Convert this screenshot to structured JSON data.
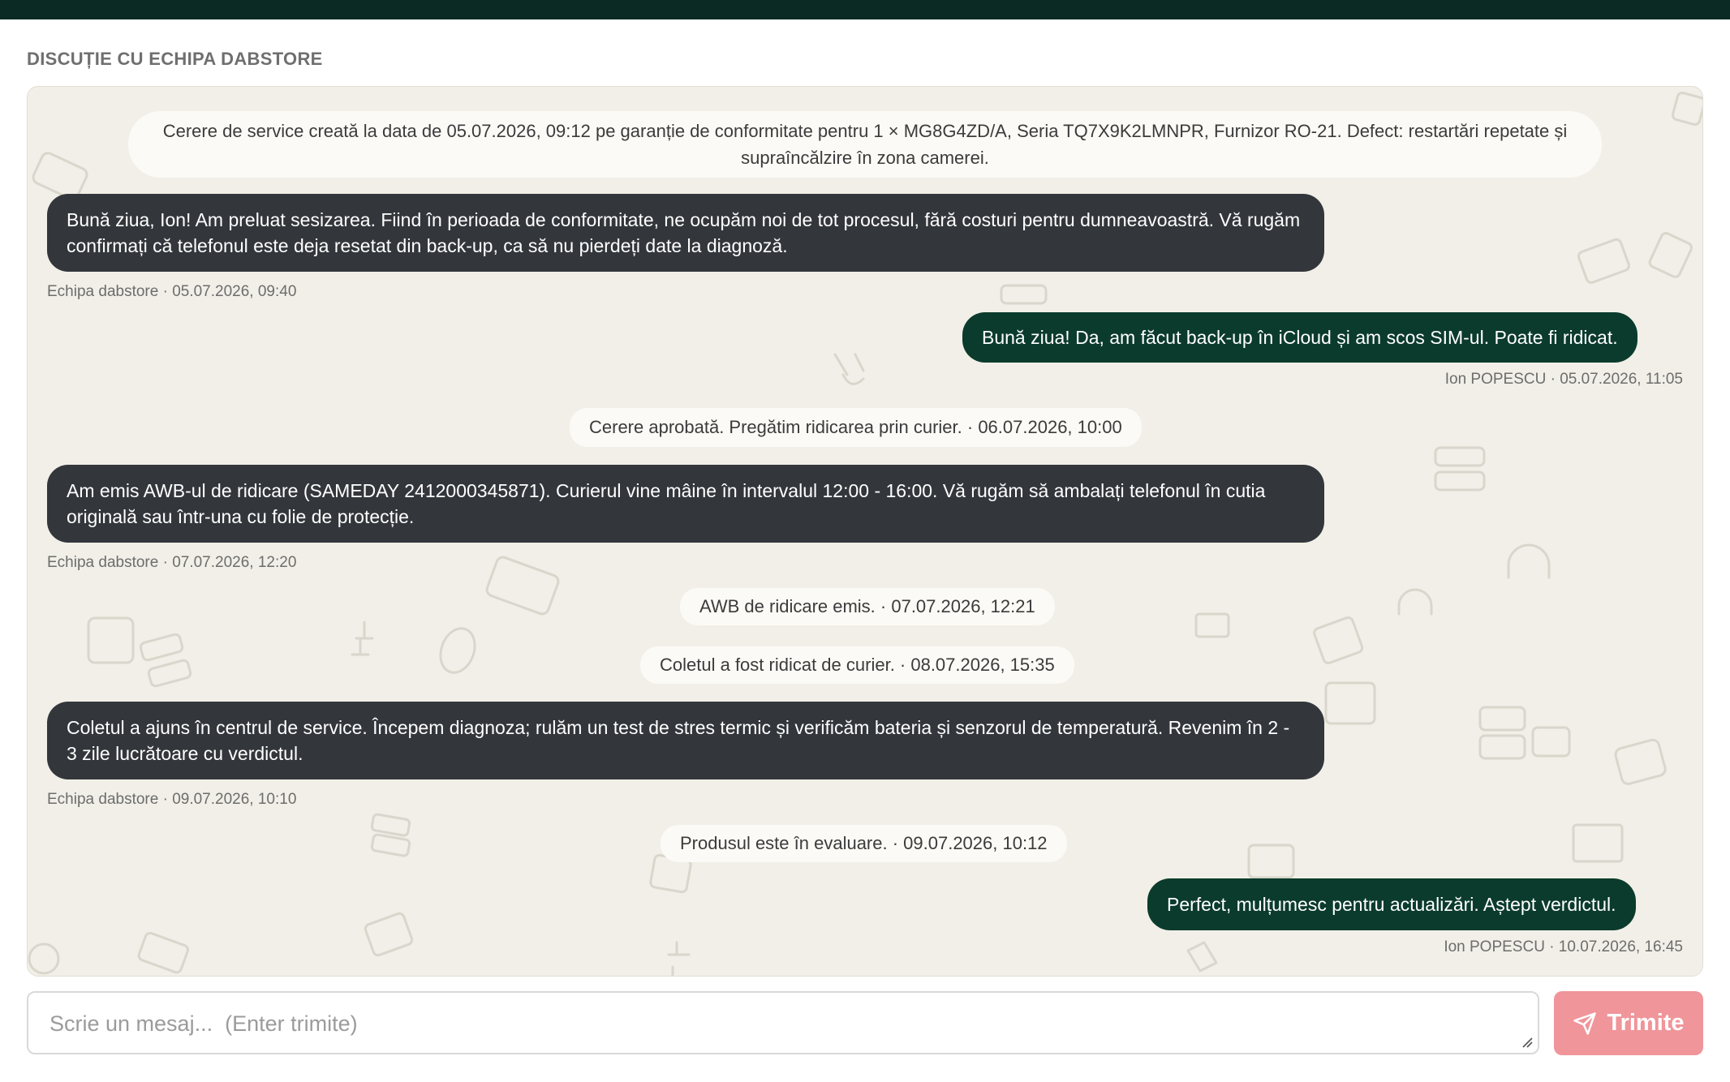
{
  "header": {
    "title": "DISCUȚIE CU ECHIPA DABSTORE"
  },
  "messages": {
    "sys1": "Cerere de service creată la data de 05.07.2026, 09:12 pe garanție de conformitate pentru 1 × MG8G4ZD/A, Seria TQ7X9K2LMNPR, Furnizor RO-21. Defect: restartări repetate și supraîncălzire în zona camerei.",
    "team1_text": "Bună ziua, Ion! Am preluat sesizarea. Fiind în perioada de conformitate, ne ocupăm noi de tot procesul, fără costuri pentru dumneavoastră. Vă rugăm confirmați că telefonul este deja resetat din back-up, ca să nu pierdeți date la diagnoză.",
    "team1_meta": "Echipa dabstore · 05.07.2026, 09:40",
    "user1_text": "Bună ziua! Da, am făcut back-up în iCloud și am scos SIM-ul. Poate fi ridicat.",
    "user1_meta": "Ion POPESCU · 05.07.2026, 11:05",
    "sys2": "Cerere aprobată. Pregătim ridicarea prin curier. · 06.07.2026, 10:00",
    "team2_text": "Am emis AWB-ul de ridicare (SAMEDAY 2412000345871). Curierul vine mâine în intervalul 12:00 - 16:00. Vă rugăm să ambalați telefonul în cutia originală sau într-una cu folie de protecție.",
    "team2_meta": "Echipa dabstore · 07.07.2026, 12:20",
    "sys3": "AWB de ridicare emis. · 07.07.2026, 12:21",
    "sys4": "Coletul a fost ridicat de curier. · 08.07.2026, 15:35",
    "team3_text": "Coletul a ajuns în centrul de service. Începem diagnoza; rulăm un test de stres termic și verificăm bateria și senzorul de temperatură. Revenim în 2 - 3 zile lucrătoare cu verdictul.",
    "team3_meta": "Echipa dabstore · 09.07.2026, 10:10",
    "sys5": "Produsul este în evaluare. · 09.07.2026, 10:12",
    "user2_text": "Perfect, mulțumesc pentru actualizări. Aștept verdictul.",
    "user2_meta": "Ion POPESCU · 10.07.2026, 16:45"
  },
  "composer": {
    "placeholder": "Scrie un mesaj...  (Enter trimite)",
    "send_label": "Trimite",
    "send_icon": "paper-plane-icon"
  },
  "colors": {
    "top_bar": "#0b2a23",
    "chat_background": "#f1efe7",
    "team_bubble": "#33363b",
    "user_bubble": "#0b3b2c",
    "send_button": "#f0959a"
  }
}
